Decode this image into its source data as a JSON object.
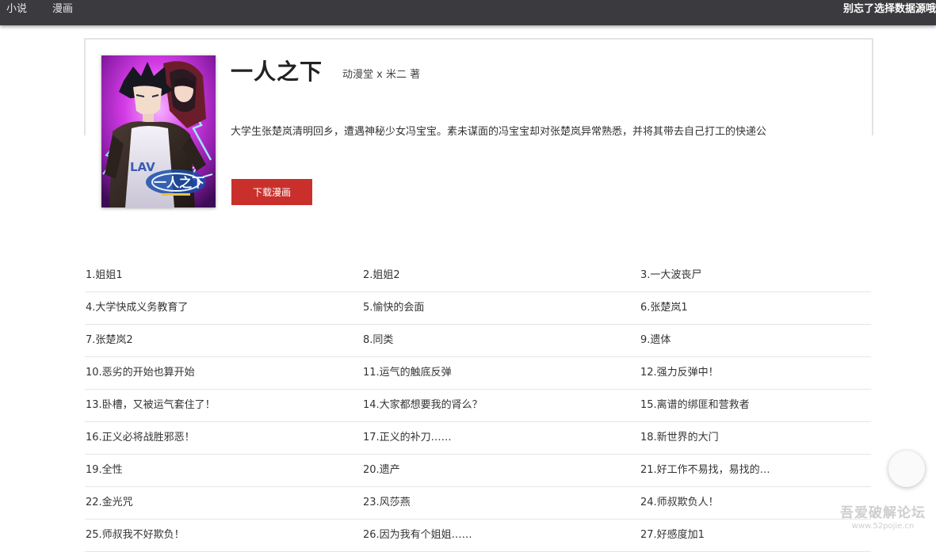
{
  "nav": {
    "items": [
      "小说",
      "漫画"
    ],
    "right_text": "别忘了选择数据源哦"
  },
  "book": {
    "title": "一人之下",
    "author": "动漫堂 x 米二 著",
    "description": "大学生张楚岚清明回乡，遭遇神秘少女冯宝宝。素未谋面的冯宝宝却对张楚岚异常熟悉，并将其带去自己打工的快递公",
    "download_label": "下载漫画",
    "cover_logo_text": "一人之下"
  },
  "chapters": [
    "1.姐姐1",
    "2.姐姐2",
    "3.一大波丧尸",
    "4.大学快成义务教育了",
    "5.愉快的会面",
    "6.张楚岚1",
    "7.张楚岚2",
    "8.同类",
    "9.遗体",
    "10.恶劣的开始也算开始",
    "11.运气的触底反弹",
    "12.强力反弹中！",
    "13.卧槽，又被运气套住了！",
    "14.大家都想要我的肾么？",
    "15.离谱的绑匪和营救者",
    "16.正义必将战胜邪恶！",
    "17.正义的补刀……",
    "18.新世界的大门",
    "19.全性",
    "20.遗产",
    "21.好工作不易找，易找的…",
    "22.金光咒",
    "23.风莎燕",
    "24.师叔欺负人！",
    "25.师叔我不好欺负！",
    "26.因为我有个姐姐……",
    "27.好感度加1"
  ],
  "watermark": {
    "line1": "吾爱破解论坛",
    "line2": "www.52pojie.cn"
  },
  "colors": {
    "topbar": "#3b3b3f",
    "button": "#c9302c"
  }
}
